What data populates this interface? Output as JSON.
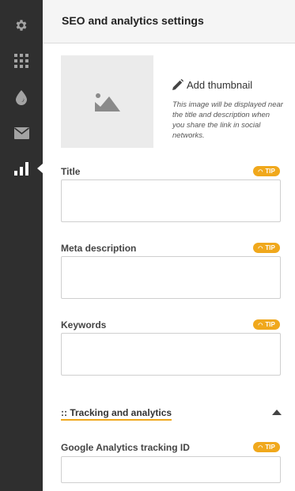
{
  "header": {
    "title": "SEO and analytics settings"
  },
  "sidebar": {
    "items": [
      {
        "icon": "gear-icon",
        "active": false
      },
      {
        "icon": "grid-icon",
        "active": false
      },
      {
        "icon": "drop-icon",
        "active": false
      },
      {
        "icon": "mail-icon",
        "active": false
      },
      {
        "icon": "bar-chart-icon",
        "active": true
      }
    ],
    "icon_color": "#a3a3a3",
    "active_icon_color": "#ffffff"
  },
  "thumbnail": {
    "add_label": "Add thumbnail",
    "help_text": "This image will be displayed near the title and description when you share the link in social networks."
  },
  "fields": {
    "title": {
      "label": "Title",
      "value": "",
      "tip": "TIP"
    },
    "meta_description": {
      "label": "Meta description",
      "value": "",
      "tip": "TIP"
    },
    "keywords": {
      "label": "Keywords",
      "value": "",
      "tip": "TIP"
    },
    "ga_tracking_id": {
      "label": "Google Analytics tracking ID",
      "value": "",
      "tip": "TIP"
    }
  },
  "tracking_section": {
    "title": ":: Tracking and analytics",
    "expanded": true
  },
  "colors": {
    "accent": "#f0a81c",
    "sidebar_bg": "#2f2f2f",
    "header_bg": "#f5f5f5"
  }
}
